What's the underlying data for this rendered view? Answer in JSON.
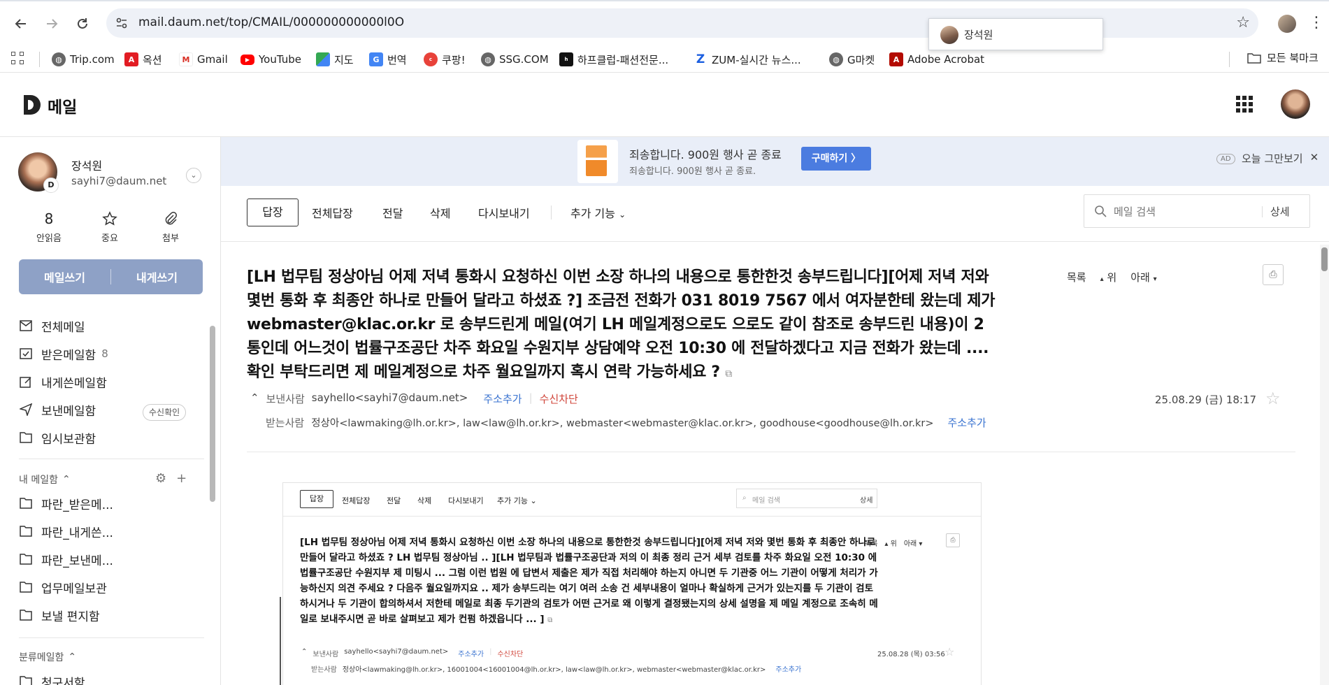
{
  "browser": {
    "url": "mail.daum.net/top/CMAIL/000000000000l0O",
    "profile_popup_name": "장석원",
    "bookmarks": [
      {
        "label": "Trip.com",
        "icon": "globe-icon"
      },
      {
        "label": "옥션",
        "icon": "auction-icon"
      },
      {
        "label": "Gmail",
        "icon": "gmail-icon"
      },
      {
        "label": "YouTube",
        "icon": "youtube-icon"
      },
      {
        "label": "지도",
        "icon": "maps-icon"
      },
      {
        "label": "번역",
        "icon": "translate-icon"
      },
      {
        "label": "쿠팡!",
        "icon": "coupang-icon"
      },
      {
        "label": "SSG.COM",
        "icon": "globe-icon"
      },
      {
        "label": "하프클럽-패션전문...",
        "icon": "halfclub-icon"
      },
      {
        "label": "ZUM-실시간 뉴스...",
        "icon": "zum-icon"
      },
      {
        "label": "G마켓",
        "icon": "globe-icon"
      },
      {
        "label": "Adobe Acrobat",
        "icon": "acrobat-icon"
      }
    ],
    "all_bookmarks_label": "모든 북마크"
  },
  "app": {
    "title": "메일"
  },
  "user": {
    "name": "장석원",
    "email": "sayhi7@daum.net",
    "badge": "D"
  },
  "stats": [
    {
      "value": "8",
      "label": "안읽음"
    },
    {
      "label": "중요"
    },
    {
      "label": "첨부"
    }
  ],
  "compose": {
    "write": "메일쓰기",
    "self": "내게쓰기"
  },
  "folders": [
    {
      "label": "전체메일",
      "icon": "all-mail-icon"
    },
    {
      "label": "받은메일함",
      "count": "8",
      "icon": "inbox-icon"
    },
    {
      "label": "내게쓴메일함",
      "icon": "self-mail-icon"
    },
    {
      "label": "보낸메일함",
      "icon": "sent-icon",
      "badge": "수신확인"
    },
    {
      "label": "임시보관함",
      "icon": "folder-icon"
    }
  ],
  "my_folders_title": "내 메일함",
  "my_folders": [
    {
      "label": "파란_받은메..."
    },
    {
      "label": "파란_내게쓴..."
    },
    {
      "label": "파란_보낸메..."
    },
    {
      "label": "업무메일보관"
    },
    {
      "label": "보낼 편지함"
    }
  ],
  "category_title": "분류메일함",
  "category_partial": "청구서함",
  "banner": {
    "line1": "죄송합니다. 900원 행사 곧 종료",
    "line2": "죄송합니다. 900원 행사 곧 종료.",
    "button": "구매하기 〉",
    "ad": "AD",
    "dismiss": "오늘 그만보기"
  },
  "actions": [
    "답장",
    "전체답장",
    "전달",
    "삭제",
    "다시보내기"
  ],
  "more_actions": "추가 기능",
  "search": {
    "placeholder": "메일 검색",
    "detail": "상세"
  },
  "mail": {
    "subject": "[LH 법무팀 정상아님 어제 저녁 통화시 요청하신 이번 소장 하나의 내용으로 통한한것 송부드립니다][어제 저녁 저와 몇번 통화 후 최종안 하나로 만들어 달라고 하셨죠 ?] 조금전 전화가 031 8019 7567 에서 여자분한테 왔는데 제가 webmaster@klac.or.kr 로 송부드린게 메일(여기 LH 메일계정으로도 으로도 같이 참조로 송부드린 내용)이 2 통인데 어느것이 법률구조공단 차주 화요일 수원지부 상담예약 오전 10:30 에 전달하겠다고 지금 전화가 왔는데 .... 확인 부탁드리면 제 메일계정으로 차주 월요일까지 혹시 연락 가능하세요 ?",
    "nav": {
      "list": "목록",
      "up": "위",
      "down": "아래"
    },
    "sender_label": "보낸사람",
    "sender": "sayhello<sayhi7@daum.net>",
    "add_contact": "주소추가",
    "block": "수신차단",
    "recipients_label": "받는사람",
    "recipients": "정상아<lawmaking@lh.or.kr>, law<law@lh.or.kr>, webmaster<webmaster@klac.or.kr>, goodhouse<goodhouse@lh.or.kr>",
    "date": "25.08.29 (금) 18:17"
  },
  "embedded": {
    "actions": [
      "답장",
      "전체답장",
      "전달",
      "삭제",
      "다시보내기"
    ],
    "more_actions": "추가 기능",
    "search_placeholder": "메일 검색",
    "search_detail": "상세",
    "subject": "[LH 법무팀 정상아님 어제 저녁 통화시 요청하신 이번 소장 하나의 내용으로 통한한것 송부드립니다][어제 저녁 저와 몇번 통화 후 최종안 하나로 만들어 달라고 하셨죠 ? LH 법무팀 정상아님 .. ][LH 법무팀과 법률구조공단과 저의 이 최종 정리 근거 세부 검토를 차주 화요일 오전 10:30 에 법률구조공단 수원지부 제 미팅시 ... 그럼 이런 법원 에 답변서 제출은 제가 직접 처리해야 하는지 아니면 두 기관중 어느 기관이 어떻게 처리가 가능하신지 의견 주세요 ? 다음주 월요일까지요 .. 제가 송부드리는 여기 여러 소송 건 세부내용이 얼마나 확실하게 근거가 있는지를 두 기관이 검토하시거나 두 기관이 합의하셔서 저한테 메일로 최종 두기관의 검토가 어떤 근거로 왜 이렇게 결정됐는지의 상세 설명을 제 메일 계정으로 조속히 메일로 보내주시면 곧 바로 살펴보고 제가 컨펌 하겠읍니다 ... ]",
    "nav": {
      "list": "목록",
      "up": "위",
      "down": "아래"
    },
    "sender_label": "보낸사람",
    "sender": "sayhello<sayhi7@daum.net>",
    "add_contact": "주소추가",
    "block": "수신차단",
    "recipients_label": "받는사람",
    "recipients": "정상아<lawmaking@lh.or.kr>, 16001004<16001004@lh.or.kr>, law<law@lh.or.kr>, webmaster<webmaster@klac.or.kr>",
    "date": "25.08.28 (목) 03:56"
  }
}
